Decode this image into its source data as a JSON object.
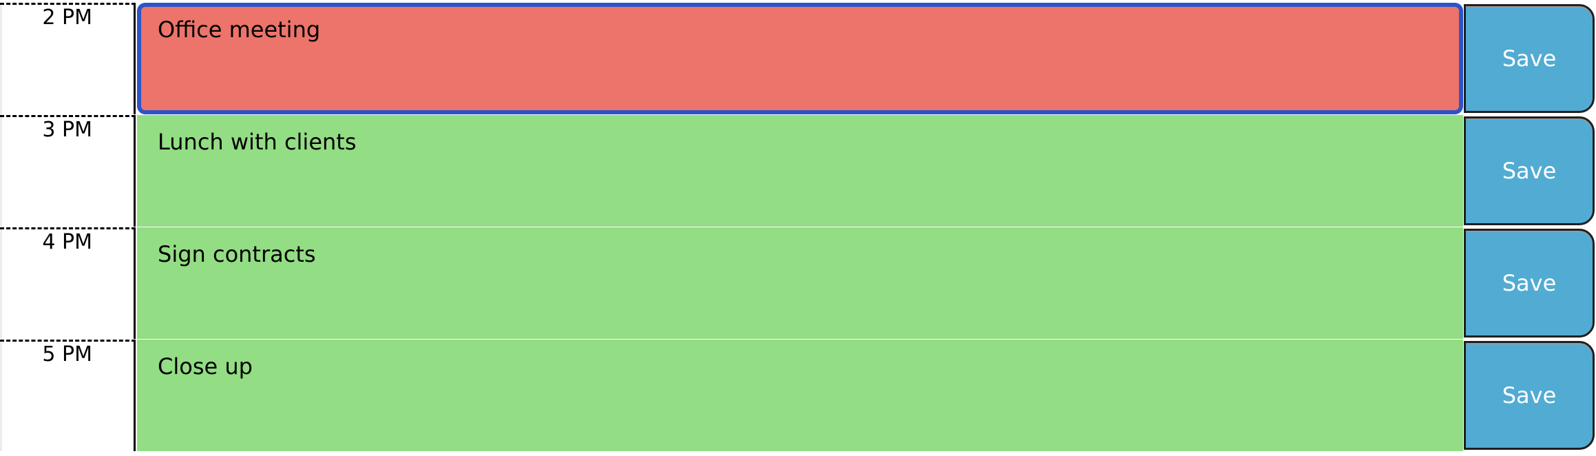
{
  "schedule": {
    "rows": [
      {
        "hour": "2 PM",
        "task": "Office meeting",
        "state": "past",
        "focused": true,
        "save_label": "Save"
      },
      {
        "hour": "3 PM",
        "task": "Lunch with clients",
        "state": "future",
        "focused": false,
        "save_label": "Save"
      },
      {
        "hour": "4 PM",
        "task": "Sign contracts",
        "state": "future",
        "focused": false,
        "save_label": "Save"
      },
      {
        "hour": "5 PM",
        "task": "Close up",
        "state": "future",
        "focused": false,
        "save_label": "Save"
      }
    ]
  },
  "colors": {
    "past": "#ec746a",
    "future": "#93dd84",
    "save_button": "#52abd3",
    "focus_ring": "#2a55c8"
  }
}
